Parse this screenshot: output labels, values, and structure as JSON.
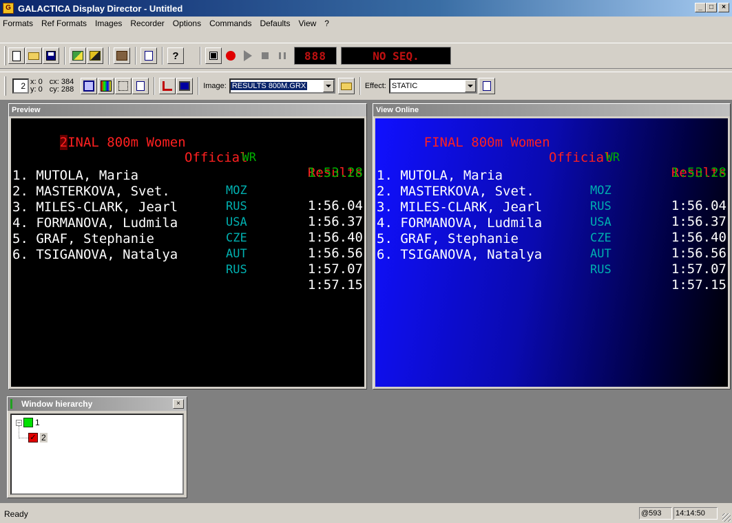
{
  "window": {
    "title": "GALACTICA Display Director - Untitled",
    "minimize": "_",
    "maximize": "□",
    "close": "×"
  },
  "menu": [
    "Formats",
    "Ref Formats",
    "Images",
    "Recorder",
    "Options",
    "Commands",
    "Defaults",
    "View",
    "?"
  ],
  "toolbar1": {
    "led_counter": "888",
    "led_sequence": "NO SEQ.",
    "help_glyph": "?"
  },
  "toolbar2": {
    "window_number": "2",
    "x_label": "x: 0",
    "y_label": "y: 0",
    "cx_label": "cx: 384",
    "cy_label": "cy: 288",
    "image_label": "Image:",
    "image_value": "RESULTS 800M.GRX",
    "effect_label": "Effect:",
    "effect_value": "STATIC"
  },
  "preview": {
    "caption": "Preview"
  },
  "online": {
    "caption": "View Online"
  },
  "scoreboard": {
    "title": "FINAL 800m Women",
    "title_preview_first": "2",
    "title_preview_rest": "INAL 800m Women",
    "official": "Official",
    "results": "Results",
    "wr_label": "WR",
    "wr_time": "1:53.28",
    "rows": [
      {
        "name": "1. MUTOLA, Maria",
        "nat": "MOZ",
        "time": "1:56.04"
      },
      {
        "name": "2. MASTERKOVA, Svet.",
        "nat": "RUS",
        "time": "1:56.37"
      },
      {
        "name": "3. MILES-CLARK, Jearl",
        "nat": "USA",
        "time": "1:56.40"
      },
      {
        "name": "4. FORMANOVA, Ludmila",
        "nat": "CZE",
        "time": "1:56.56"
      },
      {
        "name": "5. GRAF, Stephanie",
        "nat": "AUT",
        "time": "1:57.07"
      },
      {
        "name": "6. TSIGANOVA, Natalya",
        "nat": "RUS",
        "time": "1:57.15"
      }
    ]
  },
  "hierarchy": {
    "caption": "Window hierarchy",
    "close": "×",
    "expander": "−",
    "node1": "1",
    "node2": "2",
    "check": "✓"
  },
  "status": {
    "text": "Ready",
    "counter": "@593",
    "clock": "14:14:50"
  }
}
